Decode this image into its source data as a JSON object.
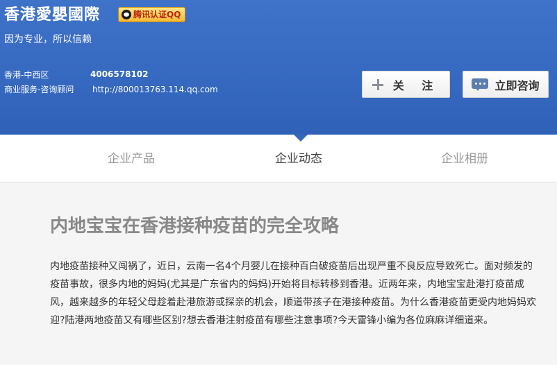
{
  "header": {
    "company_name": "香港愛嬰國際",
    "badge_label": "腾讯认证QQ",
    "slogan": "因为专业，所以信赖",
    "address": "香港-中西区",
    "service": "商业服务-咨询顾问",
    "phone": "4006578102",
    "url": "http://800013763.114.qq.com",
    "follow_label": "关 注",
    "consult_label": "立即咨询",
    "colors": {
      "bg": "#3468bd",
      "badge_text": "#b8260f"
    }
  },
  "nav": {
    "tabs": [
      {
        "label": "企业产品",
        "active": false
      },
      {
        "label": "企业动态",
        "active": true
      },
      {
        "label": "企业相册",
        "active": false
      }
    ]
  },
  "article": {
    "title": "内地宝宝在香港接种疫苗的完全攻略",
    "body": "内地疫苗接种又闯祸了，近日，云南一名4个月婴儿在接种百白破疫苗后出现严重不良反应导致死亡。面对频发的疫苗事故，很多内地的妈妈(尤其是广东省内的妈妈)开始将目标转移到香港。近两年来，内地宝宝赴港打疫苗成风，越来越多的年轻父母趁着赴港旅游或探亲的机会，顺道带孩子在港接种疫苗。为什么香港疫苗更受内地妈妈欢迎?陆港两地疫苗又有哪些区别?想去香港注射疫苗有哪些注意事项?今天雷锋小编为各位麻麻详细道来。"
  }
}
